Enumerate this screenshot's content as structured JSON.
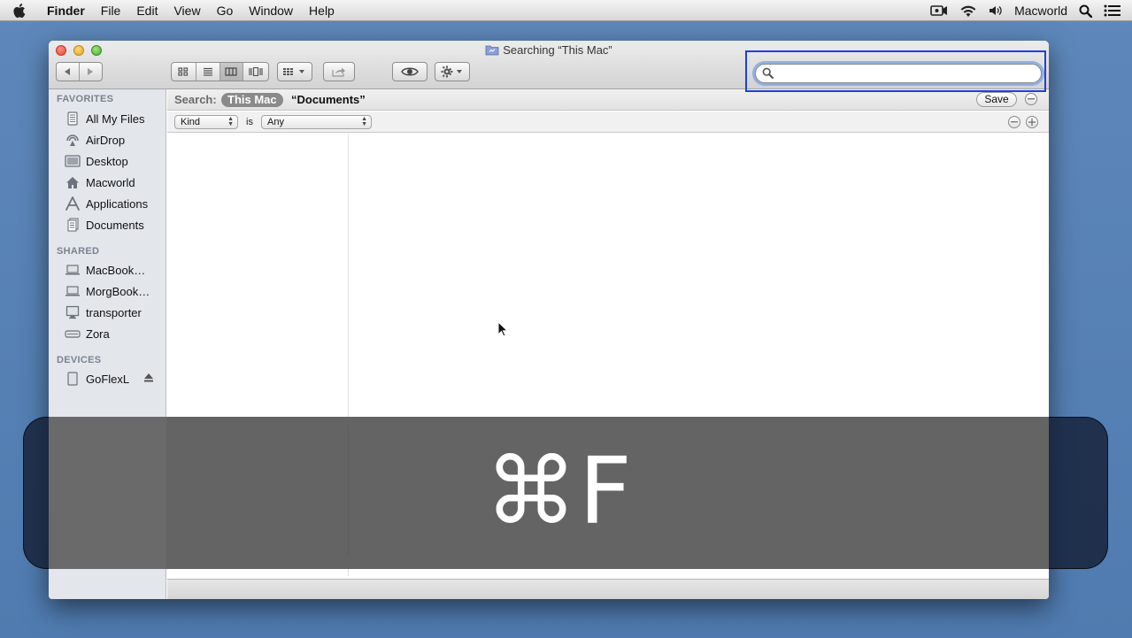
{
  "menubar": {
    "app_name": "Finder",
    "menus": [
      "File",
      "Edit",
      "View",
      "Go",
      "Window",
      "Help"
    ],
    "user": "Macworld"
  },
  "window": {
    "title": "Searching “This Mac”",
    "search_field_value": "",
    "search_highlight_color": "#1e3fe0"
  },
  "sidebar": {
    "favorites_heading": "FAVORITES",
    "favorites": [
      {
        "label": "All My Files",
        "icon": "all-files-icon"
      },
      {
        "label": "AirDrop",
        "icon": "airdrop-icon"
      },
      {
        "label": "Desktop",
        "icon": "desktop-icon"
      },
      {
        "label": "Macworld",
        "icon": "home-icon"
      },
      {
        "label": "Applications",
        "icon": "applications-icon"
      },
      {
        "label": "Documents",
        "icon": "documents-icon"
      }
    ],
    "shared_heading": "SHARED",
    "shared": [
      {
        "label": "MacBook…",
        "icon": "laptop-icon"
      },
      {
        "label": "MorgBook…",
        "icon": "laptop-icon"
      },
      {
        "label": "transporter",
        "icon": "display-icon"
      },
      {
        "label": "Zora",
        "icon": "server-icon"
      }
    ],
    "devices_heading": "DEVICES",
    "devices": [
      {
        "label": "GoFlexL",
        "icon": "drive-icon"
      }
    ]
  },
  "search": {
    "scope_label": "Search:",
    "scope_this_mac": "This Mac",
    "scope_documents": "“Documents”",
    "save_label": "Save",
    "criteria_attribute": "Kind",
    "criteria_operator": "is",
    "criteria_value": "Any"
  },
  "overlay": {
    "shortcut": "⌘F"
  }
}
